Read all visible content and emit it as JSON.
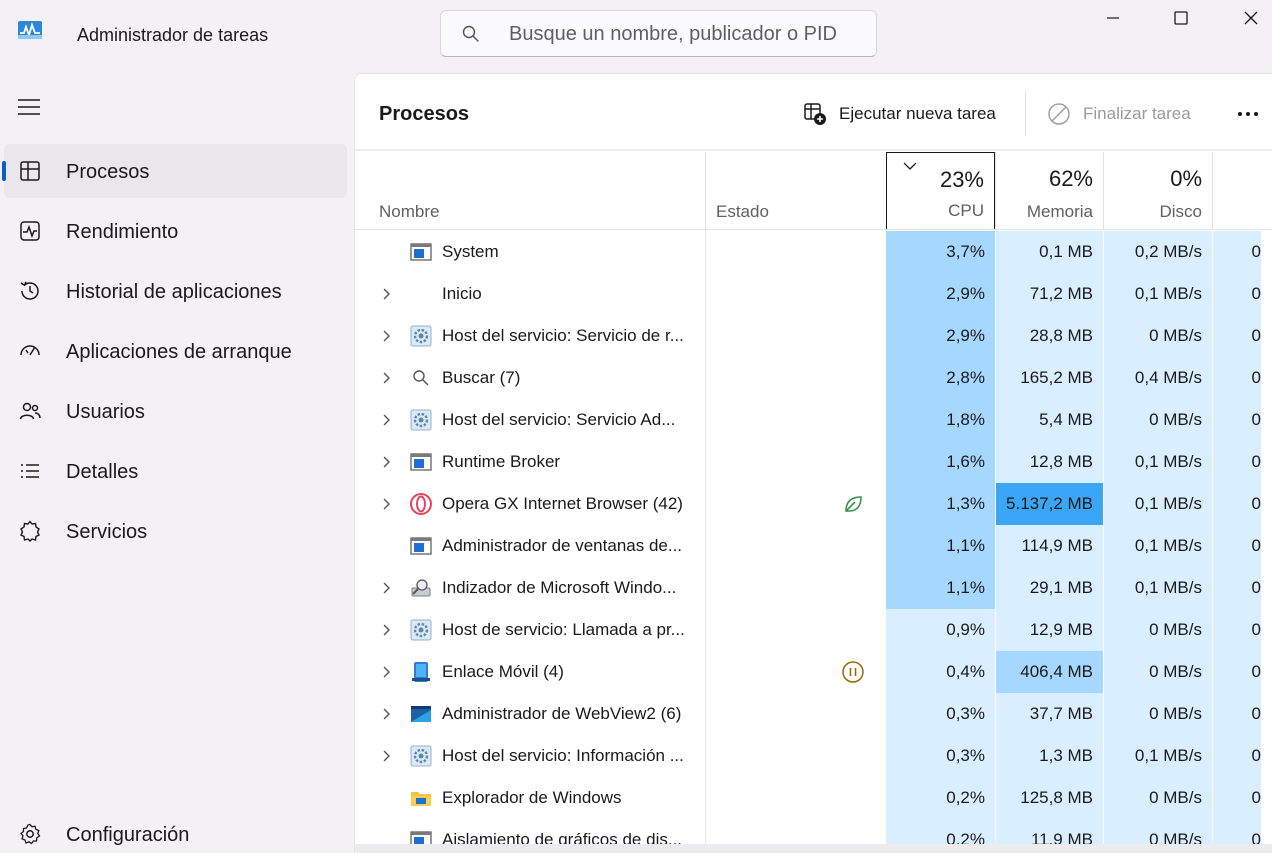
{
  "window": {
    "title": "Administrador de tareas",
    "search_placeholder": "Busque un nombre, publicador o PID"
  },
  "sidebar": {
    "items": [
      {
        "label": "Procesos",
        "icon": "processes-icon",
        "active": true
      },
      {
        "label": "Rendimiento",
        "icon": "performance-icon"
      },
      {
        "label": "Historial de aplicaciones",
        "icon": "history-icon"
      },
      {
        "label": "Aplicaciones de arranque",
        "icon": "startup-icon"
      },
      {
        "label": "Usuarios",
        "icon": "users-icon"
      },
      {
        "label": "Detalles",
        "icon": "details-icon"
      },
      {
        "label": "Servicios",
        "icon": "services-icon"
      }
    ],
    "settings_label": "Configuración"
  },
  "main": {
    "title": "Procesos",
    "run_task_label": "Ejecutar nueva tarea",
    "end_task_label": "Finalizar tarea"
  },
  "table": {
    "columns": {
      "name": "Nombre",
      "state": "Estado",
      "cpu": {
        "pct": "23%",
        "label": "CPU"
      },
      "memory": {
        "pct": "62%",
        "label": "Memoria"
      },
      "disk": {
        "pct": "0%",
        "label": "Disco"
      }
    },
    "rows": [
      {
        "name": "System",
        "expand": false,
        "icon": "window-app-icon",
        "state": "",
        "cpu": "3,7%",
        "mem": "0,1 MB",
        "disk": "0,2 MB/s",
        "net": "0",
        "cpu_level": "hi",
        "mem_level": "lo"
      },
      {
        "name": "Inicio",
        "expand": true,
        "icon": "",
        "state": "",
        "cpu": "2,9%",
        "mem": "71,2 MB",
        "disk": "0,1 MB/s",
        "net": "0",
        "cpu_level": "hi",
        "mem_level": "lo"
      },
      {
        "name": "Host del servicio: Servicio de r...",
        "expand": true,
        "icon": "gear-service-icon",
        "state": "",
        "cpu": "2,9%",
        "mem": "28,8 MB",
        "disk": "0 MB/s",
        "net": "0",
        "cpu_level": "hi",
        "mem_level": "lo"
      },
      {
        "name": "Buscar (7)",
        "expand": true,
        "icon": "search-app-icon",
        "state": "",
        "cpu": "2,8%",
        "mem": "165,2 MB",
        "disk": "0,4 MB/s",
        "net": "0",
        "cpu_level": "hi",
        "mem_level": "lo"
      },
      {
        "name": "Host del servicio: Servicio Ad...",
        "expand": true,
        "icon": "gear-service-icon",
        "state": "",
        "cpu": "1,8%",
        "mem": "5,4 MB",
        "disk": "0 MB/s",
        "net": "0",
        "cpu_level": "hi",
        "mem_level": "lo"
      },
      {
        "name": "Runtime Broker",
        "expand": true,
        "icon": "window-app-icon",
        "state": "",
        "cpu": "1,6%",
        "mem": "12,8 MB",
        "disk": "0,1 MB/s",
        "net": "0",
        "cpu_level": "hi",
        "mem_level": "lo"
      },
      {
        "name": "Opera GX Internet Browser (42)",
        "expand": true,
        "icon": "opera-icon",
        "state": "eco-leaf-icon",
        "cpu": "1,3%",
        "mem": "5.137,2 MB",
        "disk": "0,1 MB/s",
        "net": "0",
        "cpu_level": "hi",
        "mem_level": "big"
      },
      {
        "name": "Administrador de ventanas de...",
        "expand": false,
        "icon": "window-app-icon",
        "state": "",
        "cpu": "1,1%",
        "mem": "114,9 MB",
        "disk": "0,1 MB/s",
        "net": "0",
        "cpu_level": "hi",
        "mem_level": "lo"
      },
      {
        "name": "Indizador de Microsoft Windo...",
        "expand": true,
        "icon": "indexer-icon",
        "state": "",
        "cpu": "1,1%",
        "mem": "29,1 MB",
        "disk": "0,1 MB/s",
        "net": "0",
        "cpu_level": "hi",
        "mem_level": "lo"
      },
      {
        "name": "Host de servicio: Llamada a pr...",
        "expand": true,
        "icon": "gear-service-icon",
        "state": "",
        "cpu": "0,9%",
        "mem": "12,9 MB",
        "disk": "0 MB/s",
        "net": "0",
        "cpu_level": "lo",
        "mem_level": "lo"
      },
      {
        "name": "Enlace Móvil (4)",
        "expand": true,
        "icon": "phone-link-icon",
        "state": "suspended-icon",
        "cpu": "0,4%",
        "mem": "406,4 MB",
        "disk": "0 MB/s",
        "net": "0",
        "cpu_level": "lo",
        "mem_level": "mid"
      },
      {
        "name": "Administrador de WebView2 (6)",
        "expand": true,
        "icon": "webview-icon",
        "state": "",
        "cpu": "0,3%",
        "mem": "37,7 MB",
        "disk": "0 MB/s",
        "net": "0",
        "cpu_level": "lo",
        "mem_level": "lo"
      },
      {
        "name": "Host del servicio: Información ...",
        "expand": true,
        "icon": "gear-service-icon",
        "state": "",
        "cpu": "0,3%",
        "mem": "1,3 MB",
        "disk": "0,1 MB/s",
        "net": "0",
        "cpu_level": "lo",
        "mem_level": "lo"
      },
      {
        "name": "Explorador de Windows",
        "expand": false,
        "icon": "folder-icon",
        "state": "",
        "cpu": "0,2%",
        "mem": "125,8 MB",
        "disk": "0 MB/s",
        "net": "0",
        "cpu_level": "lo",
        "mem_level": "lo"
      },
      {
        "name": "Aislamiento de gráficos de dis...",
        "expand": false,
        "icon": "window-app-icon",
        "state": "",
        "cpu": "0,2%",
        "mem": "11,9 MB",
        "disk": "0 MB/s",
        "net": "0",
        "cpu_level": "lo",
        "mem_level": "lo"
      }
    ]
  },
  "colors": {
    "accent": "#0a5fc4",
    "cpu_high": "#a6d7ff",
    "cpu_low": "#d9efff",
    "memory_heavy": "#3aa6f5"
  }
}
